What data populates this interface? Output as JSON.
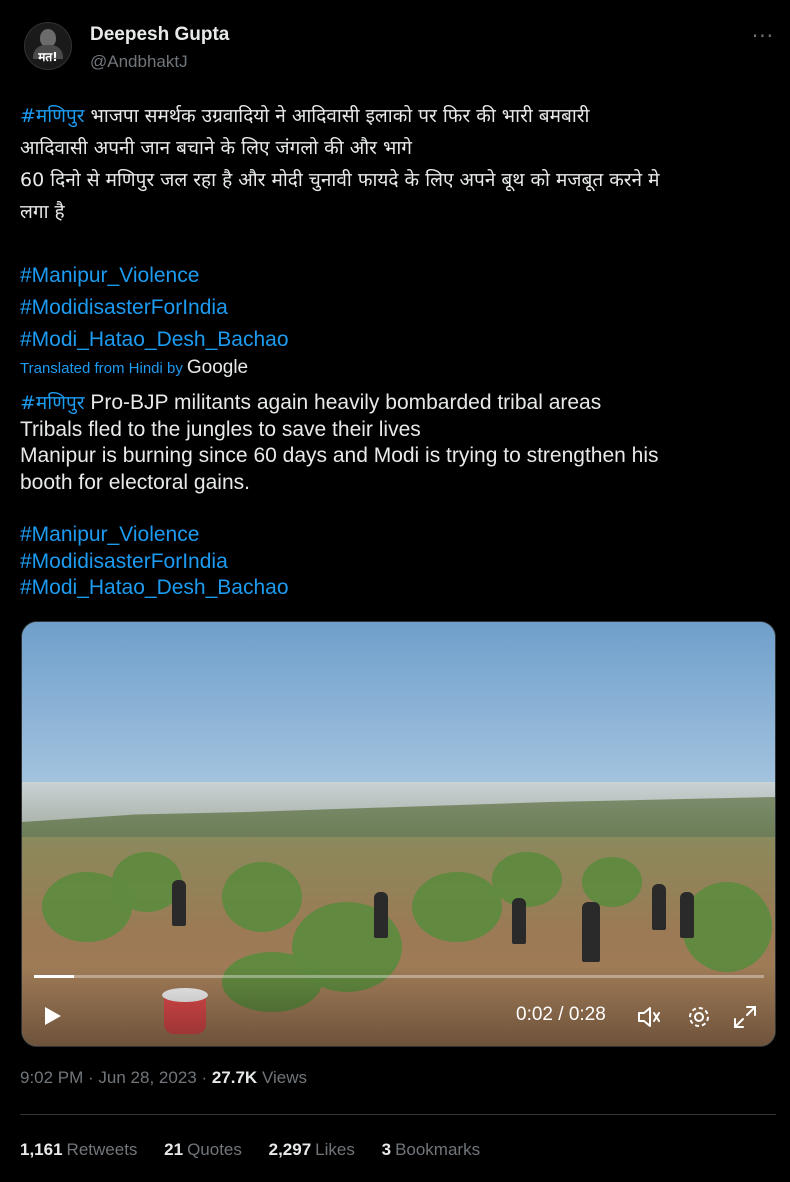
{
  "author": {
    "display_name": "Deepesh Gupta",
    "handle": "@AndbhaktJ",
    "avatar_text": "मत!"
  },
  "more_label": "···",
  "hindi": {
    "lines": [
      {
        "tag": "#मणिपुर",
        "text": " भाजपा समर्थक उग्रवादियो ने आदिवासी इलाको पर फिर की भारी बमबारी"
      },
      {
        "tag": "",
        "text": "आदिवासी अपनी जान बचाने के लिए जंगलो की और भागे"
      },
      {
        "tag": "",
        "text": "60 दिनो से मणिपुर जल रहा है और मोदी चुनावी फायदे के लिए अपने बूथ को मजबूत करने मे"
      },
      {
        "tag": "",
        "text": "लगा है"
      }
    ],
    "hashtags": [
      "#Manipur_Violence",
      "#ModidisasterForIndia",
      "#Modi_Hatao_Desh_Bachao"
    ]
  },
  "translation": {
    "label": "Translated from Hindi by",
    "provider": "Google"
  },
  "english": {
    "lines": [
      {
        "tag": "#मणिपुर",
        "text": " Pro-BJP militants again heavily bombarded tribal areas"
      },
      {
        "tag": "",
        "text": "Tribals fled to the jungles to save their lives"
      },
      {
        "tag": "",
        "text": "Manipur is burning since 60 days and Modi is trying to strengthen his"
      },
      {
        "tag": "",
        "text": "booth for electoral gains."
      }
    ],
    "hashtags": [
      "#Manipur_Violence",
      "#ModidisasterForIndia",
      "#Modi_Hatao_Desh_Bachao"
    ]
  },
  "video": {
    "current_time": "0:02",
    "separator": " / ",
    "duration": "0:28",
    "progress_fraction": 0.055,
    "icons": [
      "play-icon",
      "volume-icon",
      "settings-icon",
      "fullscreen-icon"
    ]
  },
  "meta": {
    "time": "9:02 PM",
    "dot1": " · ",
    "date": "Jun 28, 2023",
    "dot2": " · ",
    "views_count": "27.7K",
    "views_label": " Views"
  },
  "stats": [
    {
      "count": "1,161",
      "label": "Retweets"
    },
    {
      "count": "21",
      "label": "Quotes"
    },
    {
      "count": "2,297",
      "label": "Likes"
    },
    {
      "count": "3",
      "label": "Bookmarks"
    }
  ],
  "colors": {
    "background": "#000000",
    "text": "#e7e9ea",
    "muted": "#71767b",
    "link": "#1d9bf0",
    "divider": "#2f3336"
  }
}
